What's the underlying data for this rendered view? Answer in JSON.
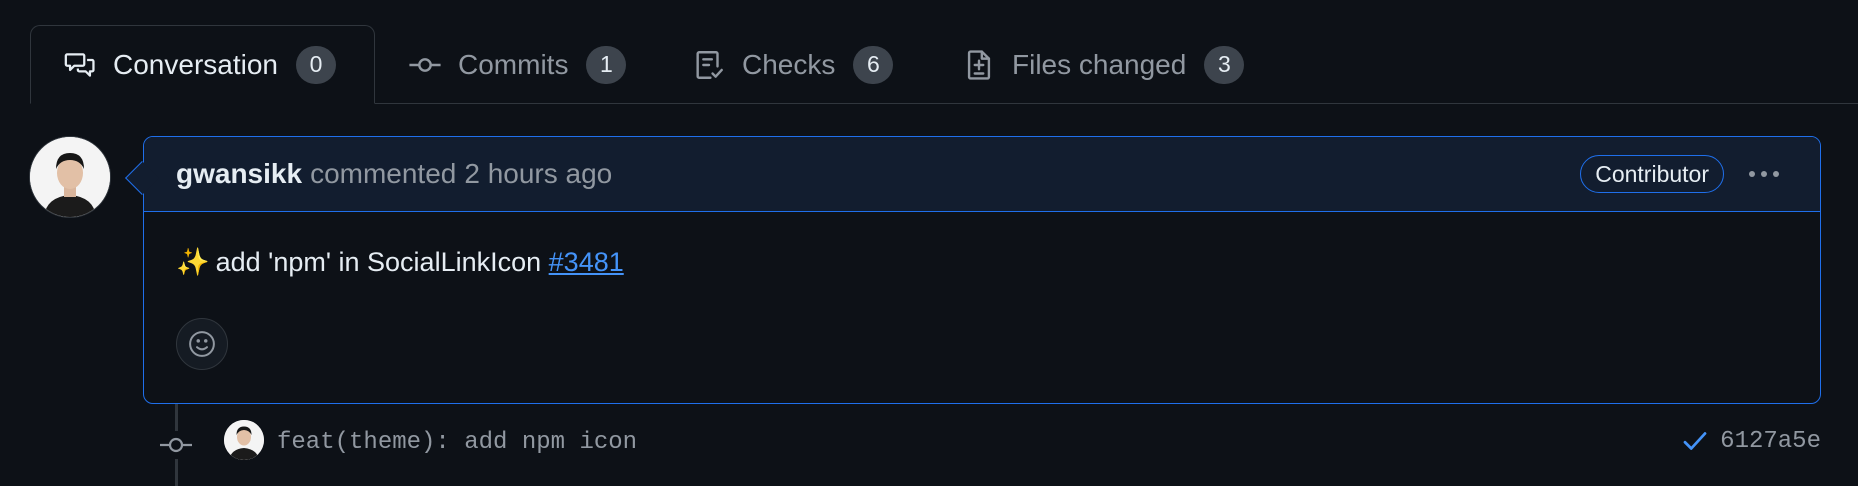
{
  "tabs": [
    {
      "label": "Conversation",
      "count": "0",
      "icon": "comment-discussion-icon",
      "active": true
    },
    {
      "label": "Commits",
      "count": "1",
      "icon": "git-commit-icon"
    },
    {
      "label": "Checks",
      "count": "6",
      "icon": "checklist-icon"
    },
    {
      "label": "Files changed",
      "count": "3",
      "icon": "file-diff-icon"
    }
  ],
  "comment": {
    "author": "gwansikk",
    "action": "commented",
    "time": "2 hours ago",
    "role_badge": "Contributor",
    "body_emoji": "✨",
    "body_text": "add 'npm' in SocialLinkIcon",
    "issue_ref": "#3481"
  },
  "commit": {
    "message": "feat(theme): add npm icon",
    "sha": "6127a5e",
    "status": "success"
  },
  "colors": {
    "background": "#0d1117",
    "accent_border": "#1f6feb",
    "header_bg": "#121d2f",
    "link": "#4493f8",
    "muted": "#9198a1",
    "success": "#4493f8"
  }
}
